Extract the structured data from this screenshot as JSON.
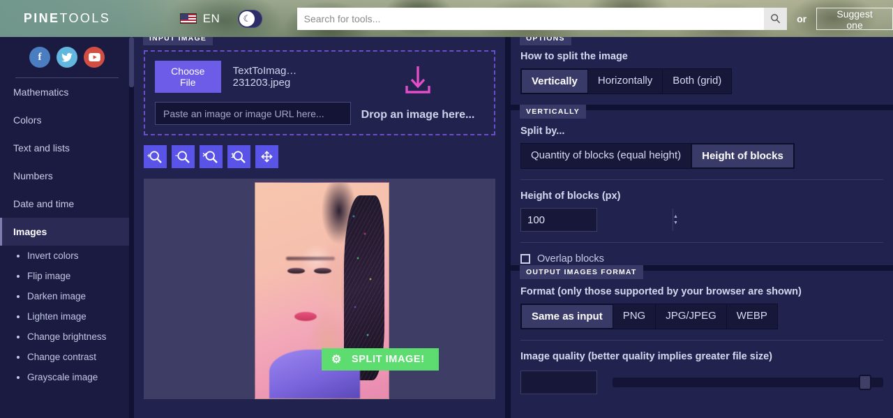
{
  "header": {
    "logo_bold": "PINE",
    "logo_light": "TOOLS",
    "menu_icon": "hamburger-icon",
    "flag_icon": "us-flag-icon",
    "language": "EN",
    "theme_toggle_icon": "moon-icon",
    "search_placeholder": "Search for tools...",
    "search_value": "",
    "search_icon": "search-icon",
    "or_label": "or",
    "suggest_label": "Suggest one"
  },
  "sidebar": {
    "social": [
      {
        "name": "facebook",
        "glyph": "f",
        "color": "#4a7ec1"
      },
      {
        "name": "twitter",
        "glyph": "ᵗ",
        "color": "#62b7de"
      },
      {
        "name": "youtube",
        "glyph": "▶",
        "color": "#d24e42"
      }
    ],
    "categories": [
      {
        "label": "Mathematics",
        "active": false
      },
      {
        "label": "Colors",
        "active": false
      },
      {
        "label": "Text and lists",
        "active": false
      },
      {
        "label": "Numbers",
        "active": false
      },
      {
        "label": "Date and time",
        "active": false
      },
      {
        "label": "Images",
        "active": true
      }
    ],
    "image_tools": [
      "Invert colors",
      "Flip image",
      "Darken image",
      "Lighten image",
      "Change brightness",
      "Change contrast",
      "Grayscale image"
    ]
  },
  "input_image": {
    "panel_tag": "INPUT IMAGE",
    "choose_file_label": "Choose File",
    "file_name": "TextToImag…231203.jpeg",
    "url_placeholder": "Paste an image or image URL here...",
    "url_value": "",
    "drop_label": "Drop an image here...",
    "drop_icon": "download-arrow-icon",
    "zoom_buttons": [
      {
        "name": "zoom-in-icon",
        "glyph": "+"
      },
      {
        "name": "zoom-out-icon",
        "glyph": "−"
      },
      {
        "name": "zoom-reset-icon",
        "glyph": "✕"
      },
      {
        "name": "zoom-actual-size-icon",
        "glyph": "1"
      },
      {
        "name": "move-icon",
        "glyph": "✛"
      }
    ]
  },
  "options": {
    "panel_tag": "OPTIONS",
    "how_to_split_label": "How to split the image",
    "split_modes": [
      {
        "label": "Vertically",
        "active": true
      },
      {
        "label": "Horizontally",
        "active": false
      },
      {
        "label": "Both (grid)",
        "active": false
      }
    ]
  },
  "vertically": {
    "panel_tag": "VERTICALLY",
    "split_by_label": "Split by...",
    "split_by_options": [
      {
        "label": "Quantity of blocks (equal height)",
        "active": false
      },
      {
        "label": "Height of blocks",
        "active": true
      }
    ],
    "height_label": "Height of blocks (px)",
    "height_value": "100",
    "overlap_label": "Overlap blocks",
    "overlap_checked": false
  },
  "output_format": {
    "panel_tag": "OUTPUT IMAGES FORMAT",
    "format_label": "Format (only those supported by your browser are shown)",
    "formats": [
      {
        "label": "Same as input",
        "active": true
      },
      {
        "label": "PNG",
        "active": false
      },
      {
        "label": "JPG/JPEG",
        "active": false
      },
      {
        "label": "WEBP",
        "active": false
      }
    ],
    "quality_label": "Image quality (better quality implies greater file size)",
    "quality_value": "",
    "quality_slider_percent": 91
  },
  "action": {
    "split_label": "SPLIT IMAGE!",
    "gear_icon": "gear-icon"
  },
  "colors": {
    "accent_purple": "#6c5ce7",
    "panel_bg": "#22224f",
    "page_bg": "#1b1b42",
    "success_green": "#5ddc6f",
    "drop_arrow_pink": "#e24ec8"
  }
}
